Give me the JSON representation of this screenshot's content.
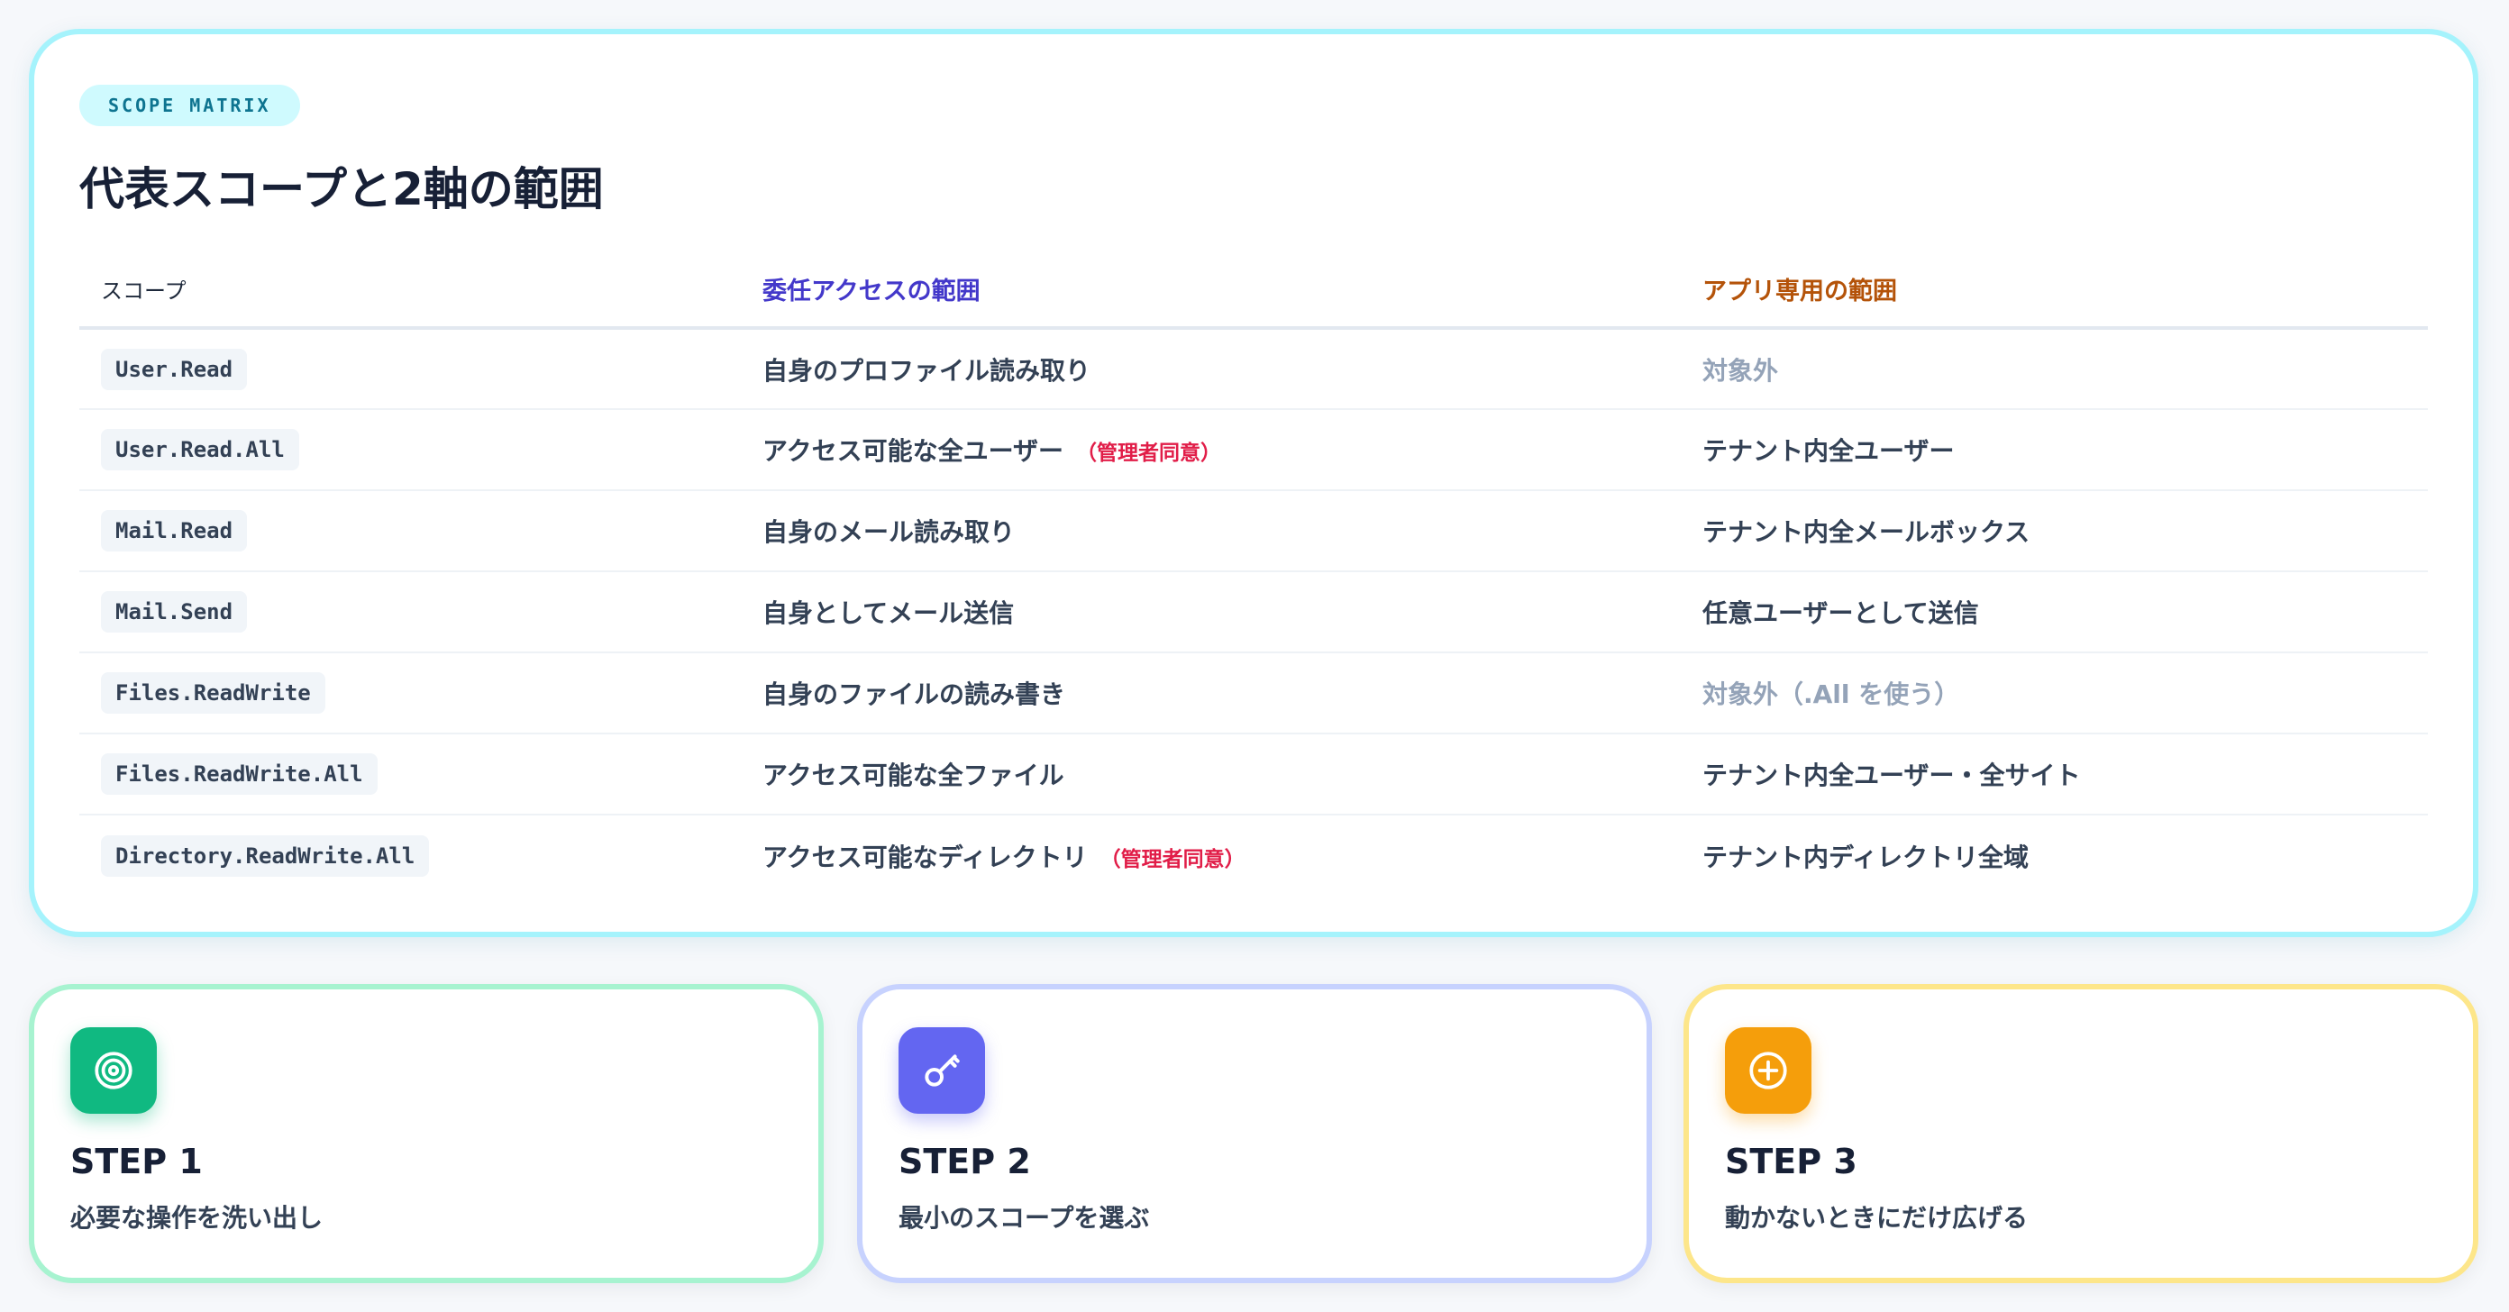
{
  "matrix": {
    "badge": "SCOPE MATRIX",
    "title": "代表スコープと2軸の範囲",
    "headers": {
      "scope": "スコープ",
      "delegated": "委任アクセスの範囲",
      "app": "アプリ専用の範囲"
    },
    "rows": [
      {
        "scope": "User.Read",
        "delegated": "自身のプロファイル読み取り",
        "delegated_note": "",
        "app": "対象外",
        "app_muted": true
      },
      {
        "scope": "User.Read.All",
        "delegated": "アクセス可能な全ユーザー",
        "delegated_note": "（管理者同意）",
        "app": "テナント内全ユーザー",
        "app_muted": false
      },
      {
        "scope": "Mail.Read",
        "delegated": "自身のメール読み取り",
        "delegated_note": "",
        "app": "テナント内全メールボックス",
        "app_muted": false
      },
      {
        "scope": "Mail.Send",
        "delegated": "自身としてメール送信",
        "delegated_note": "",
        "app": "任意ユーザーとして送信",
        "app_muted": false
      },
      {
        "scope": "Files.ReadWrite",
        "delegated": "自身のファイルの読み書き",
        "delegated_note": "",
        "app": "対象外（.All を使う）",
        "app_muted": true
      },
      {
        "scope": "Files.ReadWrite.All",
        "delegated": "アクセス可能な全ファイル",
        "delegated_note": "",
        "app": "テナント内全ユーザー・全サイト",
        "app_muted": false
      },
      {
        "scope": "Directory.ReadWrite.All",
        "delegated": "アクセス可能なディレクトリ",
        "delegated_note": "（管理者同意）",
        "app": "テナント内ディレクトリ全域",
        "app_muted": false
      }
    ]
  },
  "steps": [
    {
      "label": "STEP 1",
      "desc": "必要な操作を洗い出し",
      "icon": "target-icon",
      "color": "#10b981"
    },
    {
      "label": "STEP 2",
      "desc": "最小のスコープを選ぶ",
      "icon": "key-icon",
      "color": "#6366f1"
    },
    {
      "label": "STEP 3",
      "desc": "動かないときにだけ広げる",
      "icon": "plus-circle-icon",
      "color": "#f59e0b"
    }
  ],
  "colors": {
    "accent_cyan": "#a5f3fc",
    "delegated_header": "#4338ca",
    "app_header": "#b45309",
    "admin_consent_note": "#e11d48",
    "muted_text": "#94a3b8"
  }
}
